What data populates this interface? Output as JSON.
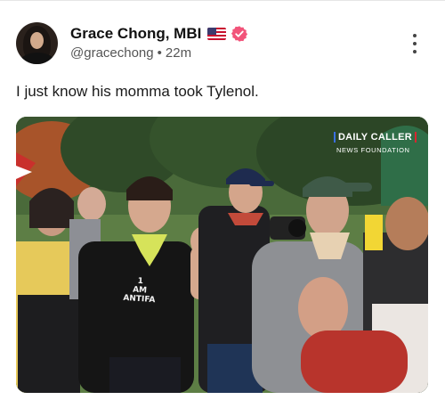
{
  "post": {
    "author": {
      "display_name": "Grace Chong, MBI",
      "handle": "@gracechong",
      "time_separator": "•",
      "posted_ago": "22m",
      "flag_icon": "us-flag-icon",
      "verified_icon": "verified-badge-icon"
    },
    "body": "I just know his momma took Tylenol.",
    "menu_icon": "more-vertical-icon",
    "media": {
      "watermark": {
        "title": "DAILY CALLER",
        "subtitle": "NEWS FOUNDATION"
      },
      "shirt_text": [
        "1",
        "AM",
        "ANTIFA"
      ]
    }
  },
  "colors": {
    "verified_badge": "#f2547a",
    "text_primary": "#111111",
    "text_secondary": "#555555"
  }
}
